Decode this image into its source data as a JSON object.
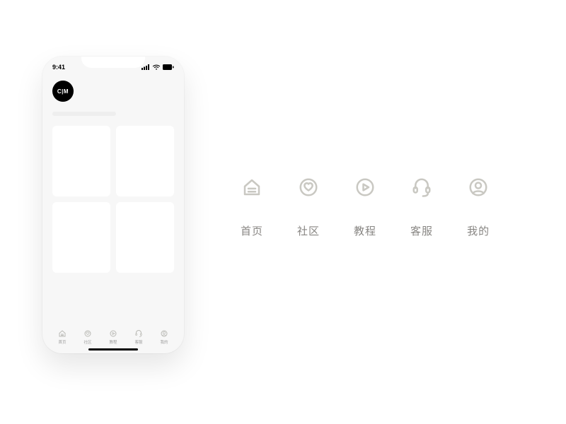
{
  "statusbar": {
    "time": "9:41"
  },
  "avatar": {
    "text": "C|M"
  },
  "nav": {
    "items": [
      {
        "name": "home",
        "label": "首页"
      },
      {
        "name": "community",
        "label": "社区"
      },
      {
        "name": "tutorial",
        "label": "教程"
      },
      {
        "name": "support",
        "label": "客服"
      },
      {
        "name": "profile",
        "label": "我的"
      }
    ]
  }
}
